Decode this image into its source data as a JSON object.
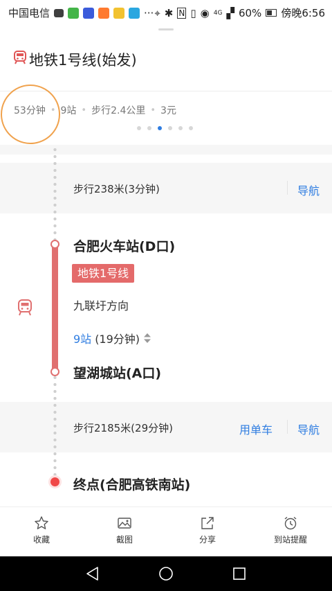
{
  "status_bar": {
    "carrier": "中国电信",
    "battery": "60%",
    "time": "傍晚6:56",
    "network": "4G"
  },
  "header": {
    "title": "地铁1号线(始发)",
    "icon": "metro-icon"
  },
  "summary": {
    "duration": "53分钟",
    "stations": "9站",
    "walk": "步行2.4公里",
    "fare": "3元",
    "page_count": 6,
    "active_page": 3
  },
  "steps": {
    "walk1": {
      "text": "步行238米(3分钟)",
      "nav": "导航"
    },
    "board": {
      "station": "合肥火车站(D口)",
      "line": "地铁1号线",
      "direction": "九联圩方向",
      "stops_count": "9站",
      "stops_time": "(19分钟)"
    },
    "alight": {
      "station": "望湖城站(A口)"
    },
    "walk2": {
      "text": "步行2185米(29分钟)",
      "bike": "用单车",
      "nav": "导航"
    },
    "end": {
      "text": "终点(合肥高铁南站)"
    }
  },
  "toolbar": {
    "favorite": "收藏",
    "screenshot": "截图",
    "share": "分享",
    "arrival_alert": "到站提醒"
  },
  "colors": {
    "accent_blue": "#2f7de1",
    "metro_red": "#e46a6a",
    "annotation_orange": "#f0a24d"
  }
}
